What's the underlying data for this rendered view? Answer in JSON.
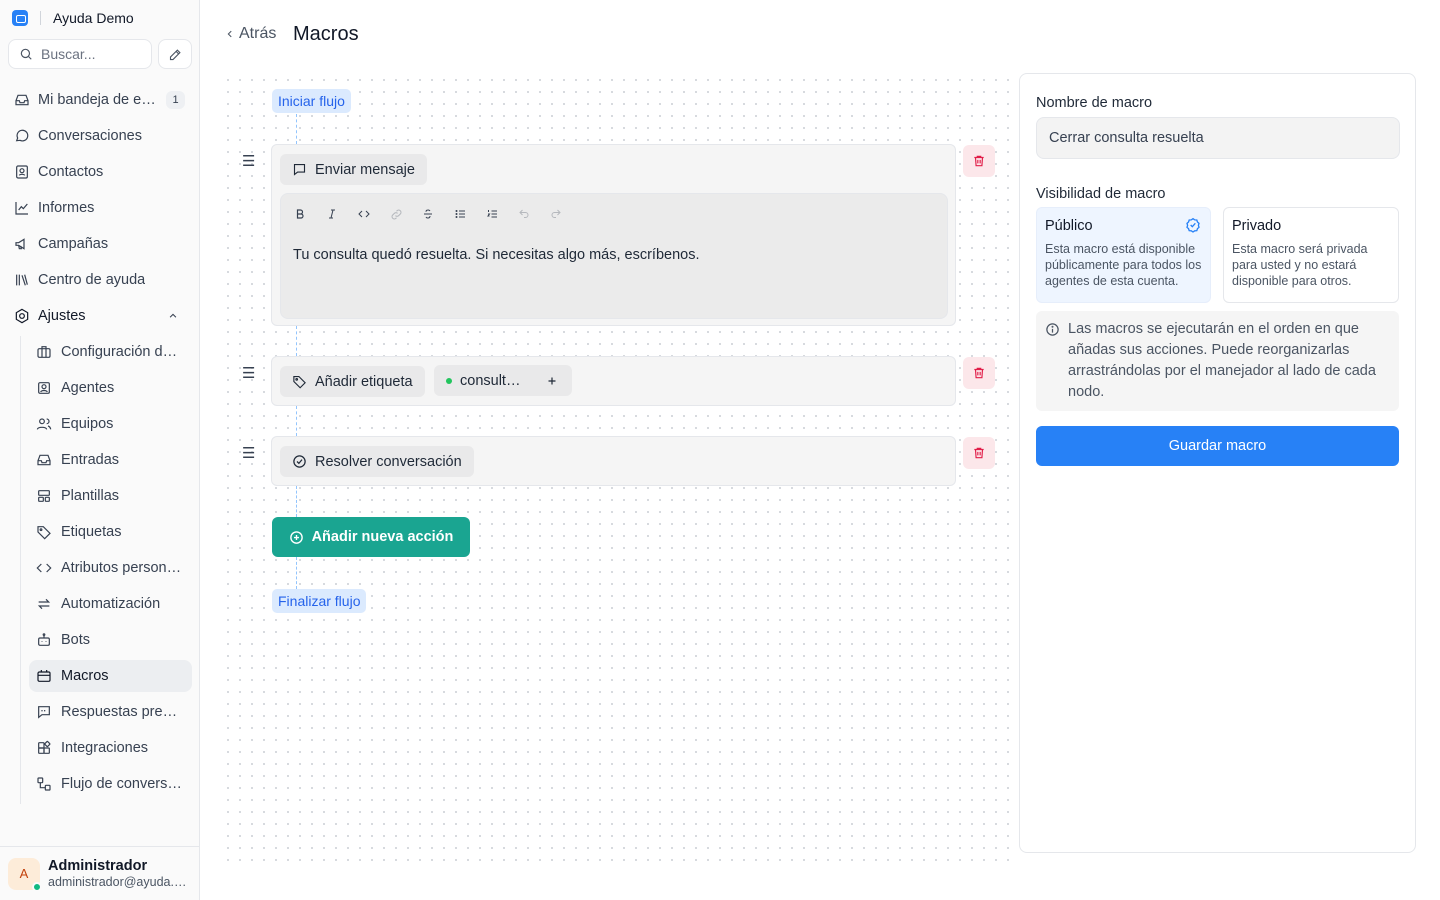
{
  "app": {
    "name": "Ayuda Demo"
  },
  "search": {
    "placeholder": "Buscar..."
  },
  "nav": {
    "items": [
      {
        "label": "Mi bandeja de entrada",
        "icon": "inbox-icon",
        "badge": "1"
      },
      {
        "label": "Conversaciones",
        "icon": "chat-bubble-icon"
      },
      {
        "label": "Contactos",
        "icon": "contact-card-icon"
      },
      {
        "label": "Informes",
        "icon": "line-chart-icon"
      },
      {
        "label": "Campañas",
        "icon": "megaphone-icon"
      },
      {
        "label": "Centro de ayuda",
        "icon": "library-icon"
      },
      {
        "label": "Ajustes",
        "icon": "settings-icon"
      }
    ],
    "settings": [
      {
        "label": "Configuración de la cuenta",
        "icon": "briefcase-icon"
      },
      {
        "label": "Agentes",
        "icon": "agent-icon"
      },
      {
        "label": "Equipos",
        "icon": "team-icon"
      },
      {
        "label": "Entradas",
        "icon": "inbox-icon"
      },
      {
        "label": "Plantillas",
        "icon": "template-icon"
      },
      {
        "label": "Etiquetas",
        "icon": "tag-icon"
      },
      {
        "label": "Atributos personalizados",
        "icon": "code-icon"
      },
      {
        "label": "Automatización",
        "icon": "automation-icon"
      },
      {
        "label": "Bots",
        "icon": "bot-icon"
      },
      {
        "label": "Macros",
        "icon": "macro-icon",
        "active": true
      },
      {
        "label": "Respuestas predefinidas",
        "icon": "canned-response-icon"
      },
      {
        "label": "Integraciones",
        "icon": "integrations-icon"
      },
      {
        "label": "Flujo de conversación",
        "icon": "flow-icon"
      }
    ]
  },
  "user": {
    "initial": "A",
    "name": "Administrador",
    "email": "administrador@ayuda.demo"
  },
  "header": {
    "back": "Atrás",
    "title": "Macros"
  },
  "flow": {
    "start": "Iniciar flujo",
    "end": "Finalizar flujo",
    "send_message": {
      "label": "Enviar mensaje",
      "text": "Tu consulta quedó resuelta. Si necesitas algo más, escríbenos."
    },
    "add_label": {
      "label": "Añadir etiqueta",
      "tag": "consulta-resuelta"
    },
    "resolve": {
      "label": "Resolver conversación"
    },
    "add_action": "Añadir nueva acción"
  },
  "panel": {
    "name_label": "Nombre de macro",
    "name_value": "Cerrar consulta resuelta",
    "visibility_label": "Visibilidad de macro",
    "public": {
      "title": "Público",
      "desc": "Esta macro está disponible públicamente para todos los agentes de esta cuenta."
    },
    "private": {
      "title": "Privado",
      "desc": "Esta macro será privada para usted y no estará disponible para otros."
    },
    "info": "Las macros se ejecutarán en el orden en que añadas sus acciones. Puede reorganizarlas arrastrándolas por el manejador al lado de cada nodo.",
    "save": "Guardar macro"
  },
  "colors": {
    "accent": "#2781f6",
    "teal": "#1aa591",
    "danger": "#e11d48"
  }
}
